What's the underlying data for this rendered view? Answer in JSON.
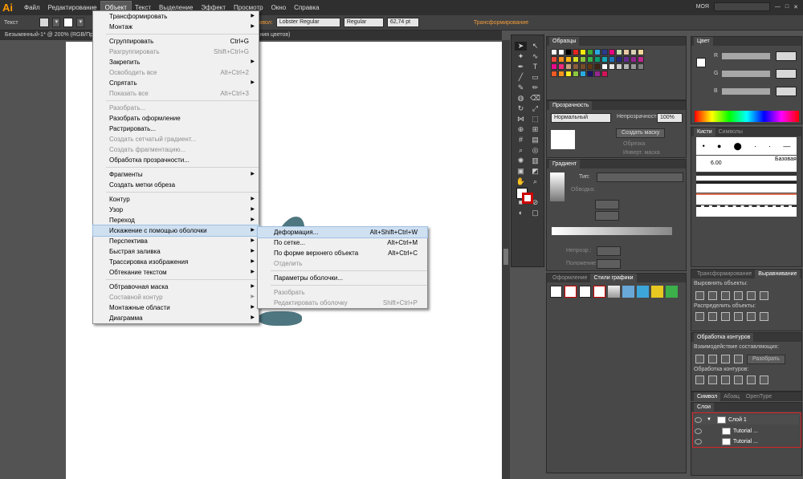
{
  "app": {
    "logo": "Ai"
  },
  "menubar": {
    "items": [
      "Файл",
      "Редактирование",
      "Объект",
      "Текст",
      "Выделение",
      "Эффект",
      "Просмотр",
      "Окно",
      "Справка"
    ],
    "active": "Объект",
    "workspace": "МОЯ"
  },
  "control_bar": {
    "label": "Текст",
    "char_label": "Символ:",
    "font": "Lobster Regular",
    "style": "Regular",
    "size": "62,74 pt",
    "transform_link": "Трансформирование"
  },
  "document_tab": {
    "title": "Безымянный-1* @ 200% (RGB/Про",
    "suffix": "вания цветов)"
  },
  "object_menu": [
    {
      "label": "Трансформировать",
      "submenu": true
    },
    {
      "label": "Монтаж",
      "submenu": true
    },
    {
      "sep": true
    },
    {
      "label": "Сгруппировать",
      "shortcut": "Ctrl+G"
    },
    {
      "label": "Разгруппировать",
      "shortcut": "Shift+Ctrl+G",
      "disabled": true
    },
    {
      "label": "Закрепить",
      "submenu": true
    },
    {
      "label": "Освободить все",
      "shortcut": "Alt+Ctrl+2",
      "disabled": true
    },
    {
      "label": "Спрятать",
      "submenu": true
    },
    {
      "label": "Показать все",
      "shortcut": "Alt+Ctrl+3",
      "disabled": true
    },
    {
      "sep": true
    },
    {
      "label": "Разобрать...",
      "disabled": true
    },
    {
      "label": "Разобрать оформление"
    },
    {
      "label": "Растрировать..."
    },
    {
      "label": "Создать сетчатый градиент...",
      "disabled": true
    },
    {
      "label": "Создать фрагментацию...",
      "disabled": true
    },
    {
      "label": "Обработка прозрачности..."
    },
    {
      "sep": true
    },
    {
      "label": "Фрагменты",
      "submenu": true
    },
    {
      "label": "Создать метки обреза"
    },
    {
      "sep": true
    },
    {
      "label": "Контур",
      "submenu": true
    },
    {
      "label": "Узор",
      "submenu": true
    },
    {
      "label": "Переход",
      "submenu": true
    },
    {
      "label": "Искажение с помощью оболочки",
      "submenu": true,
      "highlight": true
    },
    {
      "label": "Перспектива",
      "submenu": true
    },
    {
      "label": "Быстрая заливка",
      "submenu": true
    },
    {
      "label": "Трассировка изображения",
      "submenu": true
    },
    {
      "label": "Обтекание текстом",
      "submenu": true
    },
    {
      "sep": true
    },
    {
      "label": "Обтравочная маска",
      "submenu": true
    },
    {
      "label": "Составной контур",
      "submenu": true,
      "disabled": true
    },
    {
      "label": "Монтажные области",
      "submenu": true
    },
    {
      "label": "Диаграмма",
      "submenu": true
    }
  ],
  "envelope_submenu": [
    {
      "label": "Деформация...",
      "shortcut": "Alt+Shift+Ctrl+W",
      "highlight": true
    },
    {
      "label": "По сетке...",
      "shortcut": "Alt+Ctrl+M"
    },
    {
      "label": "По форме верхнего объекта",
      "shortcut": "Alt+Ctrl+C"
    },
    {
      "label": "Отделить",
      "disabled": true
    },
    {
      "sep": true
    },
    {
      "label": "Параметры оболочки..."
    },
    {
      "sep": true
    },
    {
      "label": "Разобрать",
      "disabled": true
    },
    {
      "label": "Редактировать оболочку",
      "shortcut": "Shift+Ctrl+P",
      "disabled": true
    }
  ],
  "panels": {
    "swatches": {
      "title": "Образцы"
    },
    "color": {
      "title": "Цвет",
      "r": "R",
      "g": "G",
      "b": "B"
    },
    "transparency": {
      "title": "Прозрачность",
      "mode": "Нормальный",
      "opacity_label": "Непрозрачность:",
      "opacity": "100%",
      "mask_button": "Создать маску",
      "clip": "Обрезка",
      "invert": "Инверт. маска"
    },
    "brushes": {
      "tab1": "Кисти",
      "tab2": "Символы",
      "basic": "Базовая",
      "size": "6.00"
    },
    "gradient": {
      "title": "Градиент",
      "type_label": "Тип:",
      "stroke_label": "Обводка:",
      "opacity_label": "Непрозр.:",
      "position_label": "Положение:"
    },
    "transform": {
      "tab1": "Трансформирование",
      "tab2": "Выравнивание",
      "align_label": "Выровнять объекты:",
      "distribute_label": "Распределить объекты:"
    },
    "pathfinder": {
      "title": "Обработка контуров",
      "shape_modes": "Взаимодействие составляющих:",
      "expand": "Разобрать",
      "pathfinders": "Обработка контуров:"
    },
    "appearance": {
      "tab1": "Оформление",
      "tab2": "Стили графики"
    },
    "character": {
      "tab1": "Символ",
      "tab2": "Абзац",
      "tab3": "OpenType"
    },
    "layers": {
      "title": "Слои",
      "layer": "Слой 1",
      "item1": "Tutorial ...",
      "item2": "Tutorial ..."
    }
  },
  "colors": {
    "highlight_border": "#d9252b",
    "menu_highlight": "#cfe0f1",
    "accent": "#f29b3a"
  }
}
